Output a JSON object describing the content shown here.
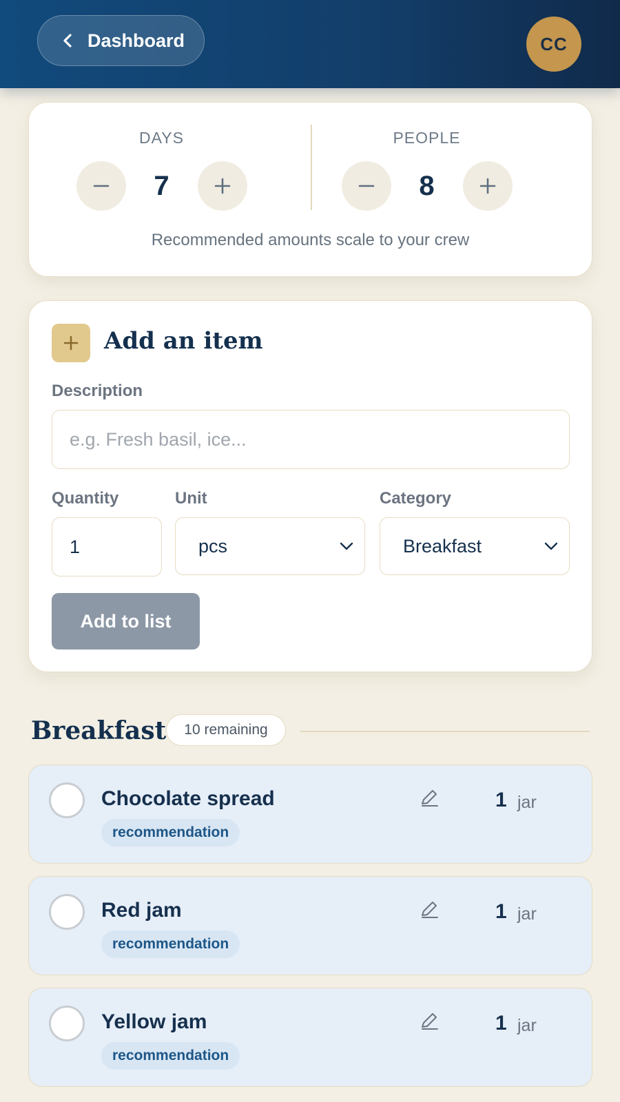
{
  "header": {
    "back_label": "Dashboard",
    "avatar_initials": "CC"
  },
  "counters": {
    "days": {
      "label": "DAYS",
      "value": "7"
    },
    "people": {
      "label": "PEOPLE",
      "value": "8"
    },
    "note": "Recommended amounts scale to your crew"
  },
  "add_item": {
    "title": "Add an item",
    "description_label": "Description",
    "description_placeholder": "e.g. Fresh basil, ice...",
    "quantity_label": "Quantity",
    "quantity_value": "1",
    "unit_label": "Unit",
    "unit_value": "pcs",
    "category_label": "Category",
    "category_value": "Breakfast",
    "submit_label": "Add to list"
  },
  "section": {
    "title": "Breakfast",
    "remaining": "10 remaining"
  },
  "items": [
    {
      "name": "Chocolate spread",
      "tag": "recommendation",
      "qty": "1",
      "unit": "jar"
    },
    {
      "name": "Red jam",
      "tag": "recommendation",
      "qty": "1",
      "unit": "jar"
    },
    {
      "name": "Yellow jam",
      "tag": "recommendation",
      "qty": "1",
      "unit": "jar"
    }
  ],
  "colors": {
    "header_bg": "#114a7c",
    "accent_gold": "#c4964e",
    "page_bg": "#f3efe4",
    "item_bg": "#e6eef8",
    "button_disabled": "#8c98a6"
  }
}
